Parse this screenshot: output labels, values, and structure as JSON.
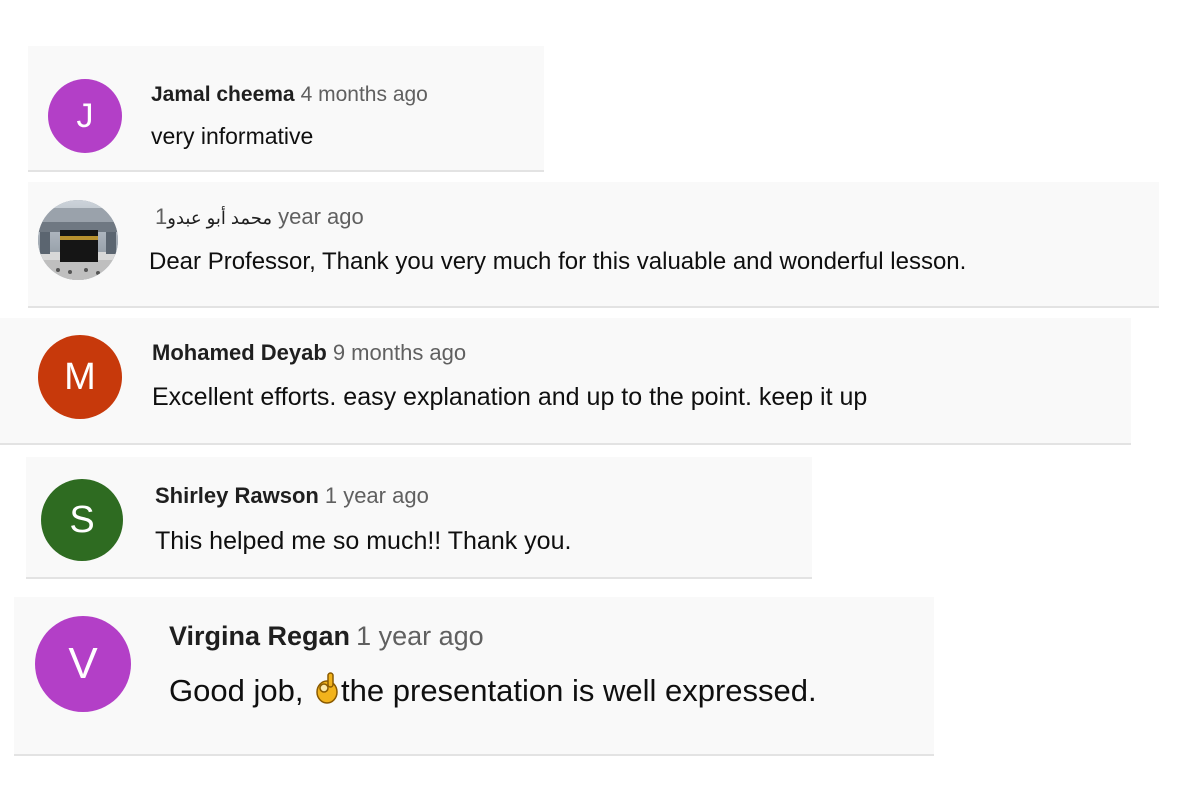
{
  "colors": {
    "card_background": "#f9f9f9",
    "author_text": "#1f1f1f",
    "timestamp_text": "#606060",
    "comment_text": "#0f0f0f"
  },
  "comments": [
    {
      "author": "Jamal cheema",
      "time": "4 months ago",
      "text": "very informative",
      "avatar": {
        "type": "initial",
        "letter": "J",
        "color": "#b33fc7"
      }
    },
    {
      "author": "محمد أبو عبدو",
      "time": "1 year ago",
      "text": "Dear Professor, Thank you very much for this valuable and wonderful lesson.",
      "avatar": {
        "type": "photo",
        "icon": "kaaba-photo-avatar"
      }
    },
    {
      "author": "Mohamed Deyab",
      "time": "9 months ago",
      "text": "Excellent efforts. easy explanation and up to the point. keep it up",
      "avatar": {
        "type": "initial",
        "letter": "M",
        "color": "#c7390b"
      }
    },
    {
      "author": "Shirley Rawson",
      "time": "1 year ago",
      "text": "This helped me so much!! Thank you.",
      "avatar": {
        "type": "initial",
        "letter": "S",
        "color": "#2e6b21"
      }
    },
    {
      "author": "Virgina Regan",
      "time": "1 year ago",
      "text_before_emoji": "Good job, ",
      "emoji": "ok-hand-emoji",
      "text_after_emoji": "the presentation is well expressed.",
      "avatar": {
        "type": "initial",
        "letter": "V",
        "color": "#b33fc7"
      }
    }
  ]
}
